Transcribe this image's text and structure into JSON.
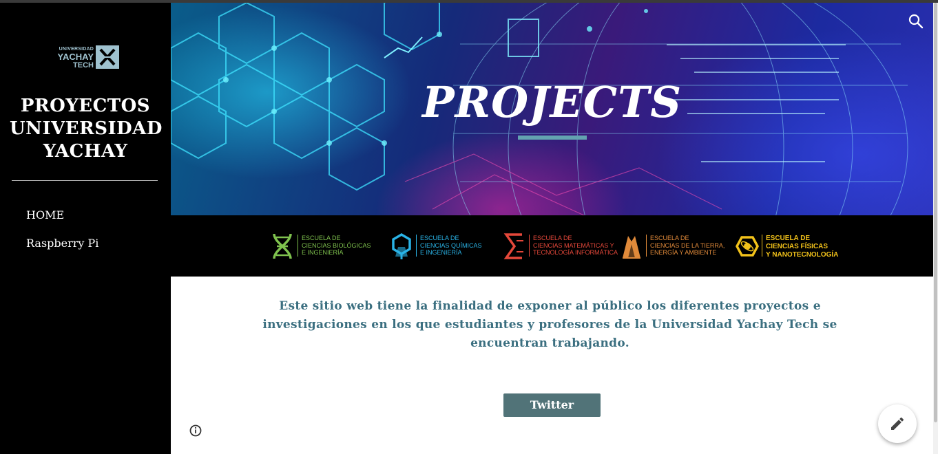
{
  "sidebar": {
    "logo": {
      "line1": "UNIVERSIDAD",
      "line2": "YACHAY",
      "line3": "TECH",
      "icon": "yachay-logo-mark"
    },
    "site_title": "PROYECTOS UNIVERSIDAD YACHAY",
    "nav": [
      {
        "label": "HOME"
      },
      {
        "label": "Raspberry Pi"
      }
    ]
  },
  "hero": {
    "title": "PROJECTS",
    "search_icon": "search-icon",
    "accent": "#63a3b0"
  },
  "schools": [
    {
      "line1": "Escuela de",
      "line2": "Ciencias Biológicas",
      "line3": "e Ingeniería",
      "color": "#7fc24e",
      "icon": "dna-icon"
    },
    {
      "line1": "Escuela de",
      "line2": "Ciencias Químicas",
      "line3": "e Ingeniería",
      "color": "#2ab3e6",
      "icon": "molecule-icon"
    },
    {
      "line1": "Escuela de",
      "line2": "Ciencias Matemáticas y",
      "line3": "Tecnología Informática",
      "color": "#e5483a",
      "icon": "sigma-icon"
    },
    {
      "line1": "Escuela de",
      "line2": "Ciencias de la Tierra,",
      "line3": "Energía y Ambiente",
      "color": "#e08a3a",
      "icon": "mountain-icon"
    },
    {
      "line1": "Escuela de",
      "line2": "Ciencias Físicas",
      "line3": "y Nanotecnología",
      "color": "#f2c21a",
      "icon": "hexagon-atom-icon"
    }
  ],
  "main": {
    "intro": "Este sitio web tiene la finalidad de exponer al público los diferentes proyectos e investigaciones en los que estudiantes y profesores de la Universidad Yachay Tech se encuentran trabajando.",
    "twitter_label": "Twitter",
    "info_icon": "info-icon",
    "edit_icon": "pencil-icon",
    "text_color": "#3b6f80",
    "button_color": "#517378"
  }
}
